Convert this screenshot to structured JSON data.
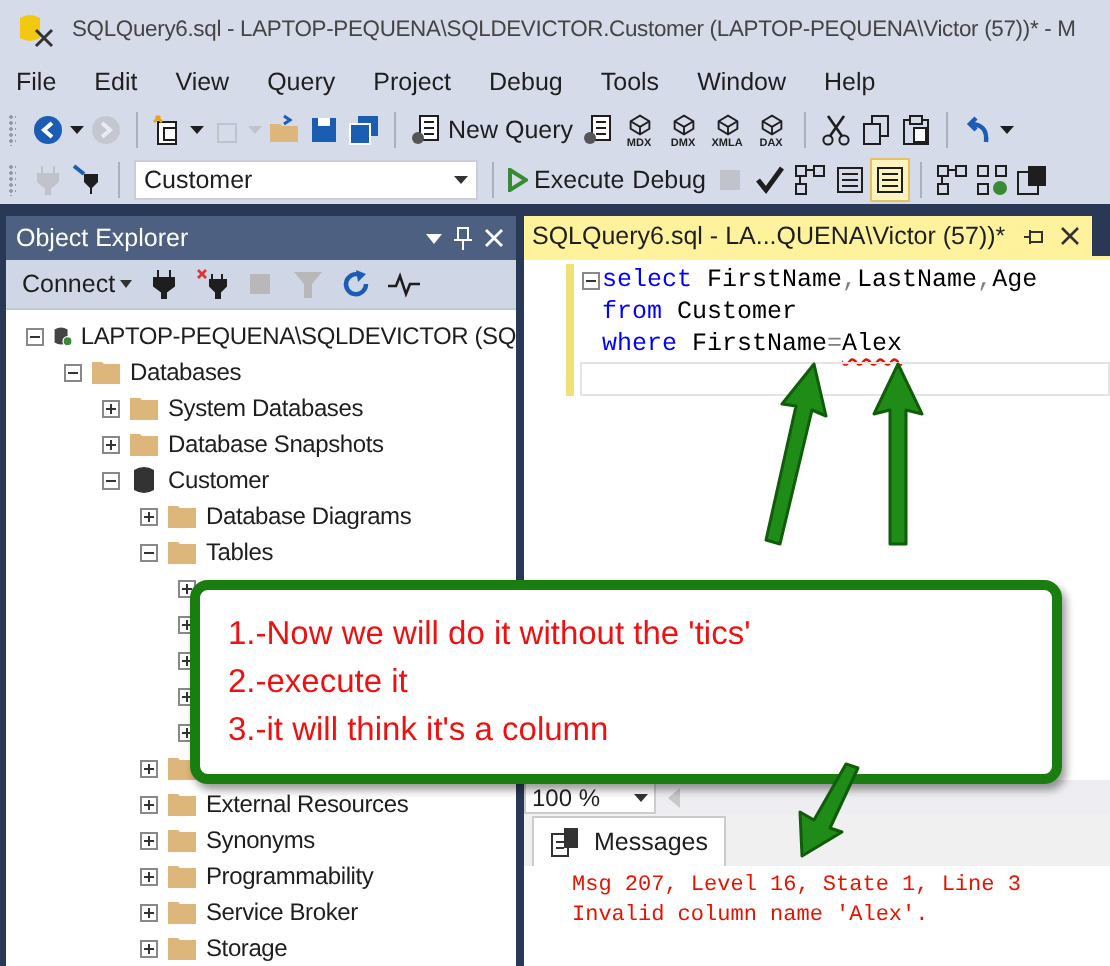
{
  "window": {
    "title": "SQLQuery6.sql - LAPTOP-PEQUENA\\SQLDEVICTOR.Customer (LAPTOP-PEQUENA\\Victor (57))* - M"
  },
  "menu": [
    "File",
    "Edit",
    "View",
    "Query",
    "Project",
    "Debug",
    "Tools",
    "Window",
    "Help"
  ],
  "toolbars": [
    [
      [
        {
          "kind": "back",
          "disabled": false
        },
        {
          "kind": "caret",
          "disabled": false
        },
        {
          "kind": "forward",
          "disabled": true
        }
      ],
      [
        {
          "kind": "newproject",
          "disabled": false
        },
        {
          "kind": "caret",
          "disabled": false
        },
        {
          "kind": "additem",
          "disabled": true
        },
        {
          "kind": "caret",
          "disabled": true
        },
        {
          "kind": "open",
          "disabled": false
        },
        {
          "kind": "save",
          "disabled": false
        },
        {
          "kind": "saveall",
          "disabled": false
        }
      ],
      [
        {
          "kind": "newquery",
          "label": "New Query",
          "disabled": false
        },
        {
          "kind": "dbquery",
          "disabled": false
        },
        {
          "kind": "cube",
          "label": "MDX",
          "disabled": false
        },
        {
          "kind": "cube",
          "label": "DMX",
          "disabled": false
        },
        {
          "kind": "cube",
          "label": "XMLA",
          "disabled": false
        },
        {
          "kind": "cube",
          "label": "DAX",
          "disabled": false
        }
      ],
      [
        {
          "kind": "cut",
          "disabled": false
        },
        {
          "kind": "copy",
          "disabled": false
        },
        {
          "kind": "paste",
          "disabled": false
        }
      ],
      [
        {
          "kind": "undo",
          "disabled": false
        },
        {
          "kind": "caret",
          "disabled": false
        }
      ]
    ],
    [
      [
        {
          "kind": "plug",
          "disabled": true
        },
        {
          "kind": "plugconfig",
          "disabled": false
        }
      ],
      [
        {
          "kind": "select",
          "value": "Customer"
        }
      ],
      [
        {
          "kind": "execute",
          "label": "Execute",
          "disabled": false
        },
        {
          "kind": "textbutton",
          "label": "Debug",
          "disabled": false
        },
        {
          "kind": "stop",
          "disabled": true
        },
        {
          "kind": "check",
          "disabled": false
        },
        {
          "kind": "plan",
          "disabled": false
        },
        {
          "kind": "toggle",
          "selected": false,
          "disabled": false
        },
        {
          "kind": "toggle",
          "selected": true,
          "disabled": false
        }
      ],
      [
        {
          "kind": "plan",
          "disabled": false
        },
        {
          "kind": "plancheck",
          "disabled": false
        },
        {
          "kind": "stats",
          "disabled": false
        }
      ]
    ]
  ],
  "object_explorer": {
    "title": "Object Explorer",
    "connect": "Connect",
    "tree": [
      {
        "kind": "server",
        "label": "LAPTOP-PEQUENA\\SQLDEVICTOR (SQ",
        "expanded": true,
        "children": [
          {
            "kind": "folder",
            "label": "Databases",
            "expanded": true,
            "children": [
              {
                "kind": "folder",
                "label": "System Databases",
                "expanded": false
              },
              {
                "kind": "folder",
                "label": "Database Snapshots",
                "expanded": false
              },
              {
                "kind": "database",
                "label": "Customer",
                "expanded": true,
                "children": [
                  {
                    "kind": "folder",
                    "label": "Database Diagrams",
                    "expanded": false
                  },
                  {
                    "kind": "folder",
                    "label": "Tables",
                    "expanded": true,
                    "children": [
                      {
                        "expanded": false
                      },
                      {
                        "expanded": false
                      },
                      {
                        "expanded": false
                      },
                      {
                        "expanded": false
                      },
                      {
                        "expanded": false
                      }
                    ]
                  },
                  {
                    "kind": "folder",
                    "expanded": false
                  },
                  {
                    "kind": "folder",
                    "label": "External Resources",
                    "expanded": false
                  },
                  {
                    "kind": "folder",
                    "label": "Synonyms",
                    "expanded": false
                  },
                  {
                    "kind": "folder",
                    "label": "Programmability",
                    "expanded": false
                  },
                  {
                    "kind": "folder",
                    "label": "Service Broker",
                    "expanded": false
                  },
                  {
                    "kind": "folder",
                    "label": "Storage",
                    "expanded": false
                  }
                ]
              }
            ]
          }
        ]
      }
    ]
  },
  "editor": {
    "tab": "SQLQuery6.sql - LA...QUENA\\Victor (57))*",
    "lines": [
      [
        {
          "kind": "keyword",
          "text": "select"
        },
        {
          "kind": "plain",
          "text": " FirstName"
        },
        {
          "kind": "punct",
          "text": ","
        },
        {
          "kind": "plain",
          "text": "LastName"
        },
        {
          "kind": "punct",
          "text": ","
        },
        {
          "kind": "plain",
          "text": "Age"
        }
      ],
      [
        {
          "kind": "keyword",
          "text": "from"
        },
        {
          "kind": "plain",
          "text": " Customer"
        }
      ],
      [
        {
          "kind": "keyword",
          "text": "where"
        },
        {
          "kind": "plain",
          "text": " FirstName"
        },
        {
          "kind": "punct",
          "text": "="
        },
        {
          "kind": "error",
          "text": "Alex"
        }
      ]
    ],
    "zoom": "100 %"
  },
  "results": {
    "tab": "Messages",
    "messages": [
      "Msg 207, Level 16, State 1, Line 3",
      "Invalid column name 'Alex'."
    ]
  },
  "callout": {
    "lines": [
      "1.-Now we will do it without the 'tics'",
      "2.-execute it",
      "3.-it will think it's a column"
    ]
  }
}
